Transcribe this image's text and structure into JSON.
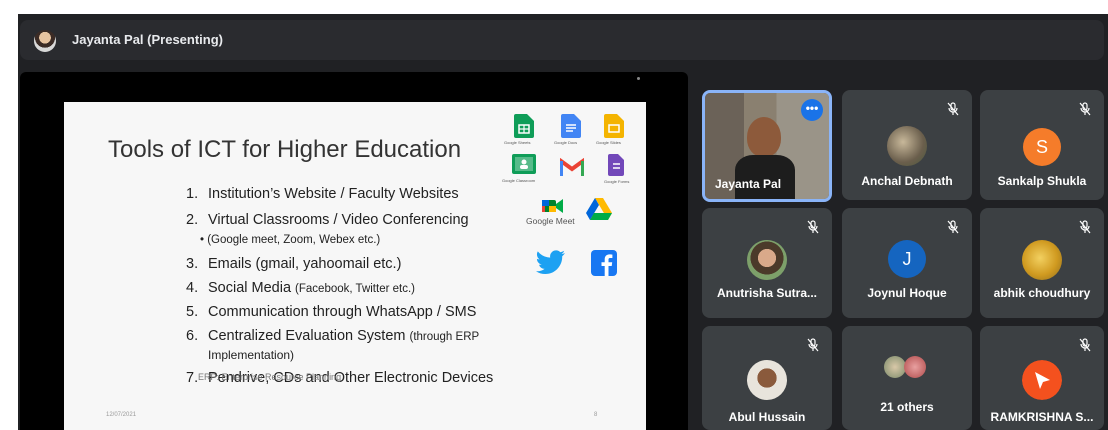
{
  "presenter": {
    "label": "Jayanta Pal (Presenting)"
  },
  "slide": {
    "title": "Tools of ICT for Higher Education",
    "items": [
      {
        "num": "1.",
        "text": "Institution’s Website /  Faculty Websites",
        "note": ""
      },
      {
        "num": "2.",
        "text": "Virtual Classrooms / Video Conferencing",
        "note": ""
      },
      {
        "num": "3.",
        "text": "Emails (gmail, yahoomail etc.)",
        "note": ""
      },
      {
        "num": "4.",
        "text": "Social Media ",
        "note": "(Facebook, Twitter etc.)"
      },
      {
        "num": "5.",
        "text": "Communication through WhatsApp / SMS",
        "note": ""
      },
      {
        "num": "6.",
        "text": "Centralized Evaluation System ",
        "note": "(through ERP"
      },
      {
        "num": "7.",
        "text": "Pendrive, CDs and Other Electronic Devices",
        "note": ""
      }
    ],
    "sub_item": "•    (Google meet, Zoom, Webex etc.)",
    "item6_line2": "Implementation)",
    "footnote": "ERP: Enterprise Resource Planning",
    "date": "12/07/2021",
    "page": "8",
    "tools": {
      "sheets": "Google Sheets",
      "docs": "Google Docs",
      "slides": "Google Slides",
      "classroom": "Google Classroom",
      "forms": "Google Forms",
      "meet": "Google Meet"
    }
  },
  "participants": [
    {
      "name": "Jayanta Pal",
      "type": "video"
    },
    {
      "name": "Anchal Debnath",
      "type": "photo"
    },
    {
      "name": "Sankalp Shukla",
      "type": "letter",
      "initial": "S",
      "color": "#f57c2a"
    },
    {
      "name": "Anutrisha Sutra...",
      "type": "photo"
    },
    {
      "name": "Joynul Hoque",
      "type": "letter",
      "initial": "J",
      "color": "#1565c0"
    },
    {
      "name": "abhik choudhury",
      "type": "photo"
    },
    {
      "name": "Abul Hussain",
      "type": "photo"
    },
    {
      "name": "21 others",
      "type": "group"
    },
    {
      "name": "RAMKRISHNA S...",
      "type": "icon",
      "color": "#f4511e"
    }
  ],
  "colors": {
    "accent": "#8ab4f8",
    "tile_bg": "#3c4043",
    "app_bg": "#202124"
  }
}
